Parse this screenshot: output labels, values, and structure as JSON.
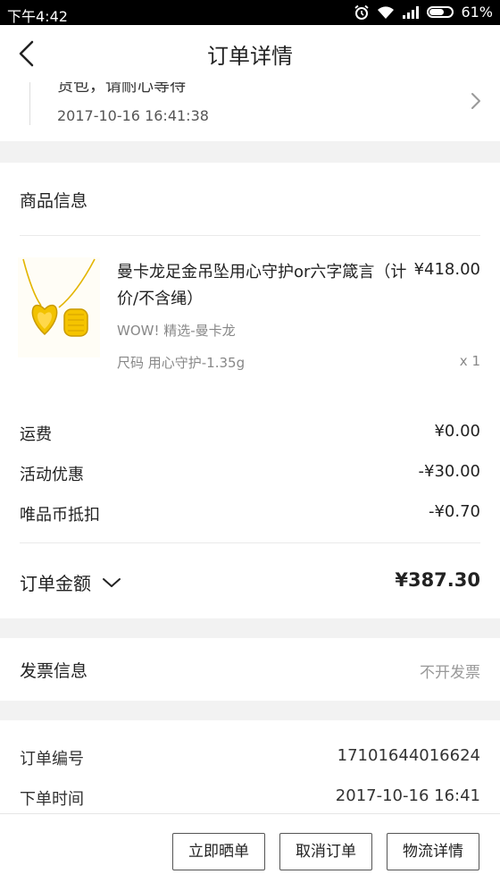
{
  "status_bar": {
    "time": "下午4:42",
    "battery": "61%"
  },
  "nav": {
    "title": "订单详情"
  },
  "tracking": {
    "message": "货包，请耐心等待",
    "timestamp": "2017-10-16 16:41:38"
  },
  "goods": {
    "heading": "商品信息",
    "product": {
      "name": "曼卡龙足金吊坠用心守护or六字箴言（计价/不含绳）",
      "price": "¥418.00",
      "shop": "WOW! 精选-曼卡龙",
      "size": "尺码 用心守护-1.35g",
      "quantity": "x 1"
    }
  },
  "fees": [
    {
      "label": "运费",
      "value": "¥0.00"
    },
    {
      "label": "活动优惠",
      "value": "-¥30.00"
    },
    {
      "label": "唯品币抵扣",
      "value": "-¥0.70"
    }
  ],
  "total": {
    "label": "订单金额",
    "value": "¥387.30"
  },
  "invoice": {
    "label": "发票信息",
    "value": "不开发票"
  },
  "order_info": {
    "number_label": "订单编号",
    "number": "17101644016624",
    "time_label": "下单时间",
    "time": "2017-10-16 16:41"
  },
  "actions": {
    "share": "立即晒单",
    "cancel": "取消订单",
    "logistics": "物流详情"
  },
  "colors": {
    "gold": "#f2c200",
    "text": "#222222",
    "muted": "#999999",
    "background": "#f2f2f2"
  }
}
